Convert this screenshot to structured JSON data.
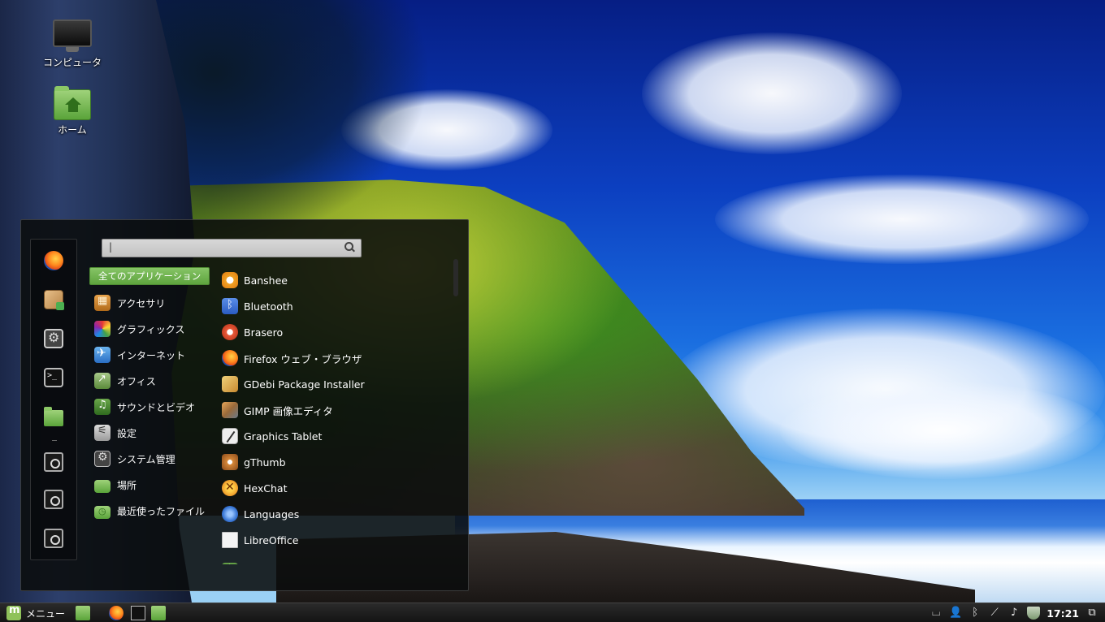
{
  "desktop": {
    "icons": [
      {
        "label": "コンピュータ",
        "icon": "computer-icon"
      },
      {
        "label": "ホーム",
        "icon": "home-folder-icon"
      }
    ]
  },
  "menu": {
    "search": {
      "value": "|",
      "placeholder": ""
    },
    "favorites": [
      {
        "name": "Firefox",
        "icon": "firefox-icon"
      },
      {
        "name": "Software Manager",
        "icon": "package-icon"
      },
      {
        "name": "System Settings",
        "icon": "settings-icon"
      },
      {
        "name": "Terminal",
        "icon": "terminal-icon"
      },
      {
        "name": "Files",
        "icon": "folder-icon"
      },
      {
        "name": "Lock Screen",
        "icon": "lock-icon"
      },
      {
        "name": "Logout",
        "icon": "logout-icon"
      },
      {
        "name": "Quit",
        "icon": "power-icon"
      }
    ],
    "categories": [
      {
        "label": "全てのアプリケーション"
      },
      {
        "label": "アクセサリ"
      },
      {
        "label": "グラフィックス"
      },
      {
        "label": "インターネット"
      },
      {
        "label": "オフィス"
      },
      {
        "label": "サウンドとビデオ"
      },
      {
        "label": "設定"
      },
      {
        "label": "システム管理"
      },
      {
        "label": "場所"
      },
      {
        "label": "最近使ったファイル"
      }
    ],
    "apps": [
      {
        "label": "Banshee"
      },
      {
        "label": "Bluetooth"
      },
      {
        "label": "Brasero"
      },
      {
        "label": "Firefox ウェブ・ブラウザ"
      },
      {
        "label": "GDebi Package Installer"
      },
      {
        "label": "GIMP 画像エディタ"
      },
      {
        "label": "Graphics Tablet"
      },
      {
        "label": "gThumb"
      },
      {
        "label": "HexChat"
      },
      {
        "label": "Languages"
      },
      {
        "label": "LibreOffice"
      }
    ]
  },
  "panel": {
    "menu_label": "メニュー",
    "clock": "17:21"
  },
  "colors": {
    "menu_accent": "#6fb44e",
    "panel_bg": "#1c1c1c"
  }
}
